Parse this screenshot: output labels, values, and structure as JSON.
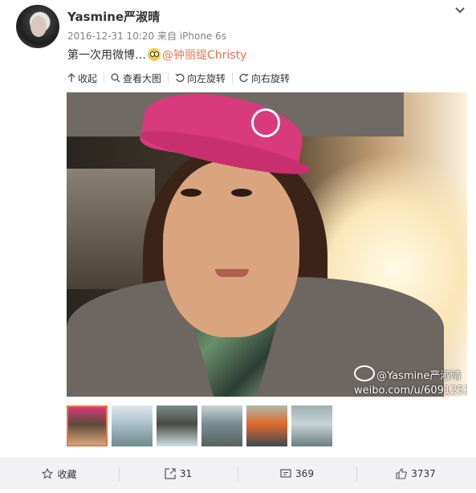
{
  "post": {
    "author": "Yasmine严淑晴",
    "date": "2016-12-31 10:20",
    "source_prefix": "来自",
    "device": "iPhone 6s",
    "text_prefix": "第一次用微博…",
    "mention": "@钟丽缇Christy"
  },
  "toolbar": {
    "collapse": "收起",
    "view_large": "查看大图",
    "rotate_left": "向左旋转",
    "rotate_right": "向右旋转"
  },
  "watermark": {
    "line1": "@Yasmine严淑晴",
    "line2": "weibo.com/u/6091253443"
  },
  "thumbnails": [
    {
      "name": "thumb-1",
      "selected": true,
      "colors": [
        "#5c4a36",
        "#d9a47e",
        "#d83a7c"
      ]
    },
    {
      "name": "thumb-2",
      "selected": false,
      "colors": [
        "#a9c0cc",
        "#6f8a8c",
        "#dfe8ea"
      ]
    },
    {
      "name": "thumb-3",
      "selected": false,
      "colors": [
        "#4a4a44",
        "#cfe0e6",
        "#7c8a88"
      ]
    },
    {
      "name": "thumb-4",
      "selected": false,
      "colors": [
        "#7a8c93",
        "#55625e",
        "#c9d4d6"
      ]
    },
    {
      "name": "thumb-5",
      "selected": false,
      "colors": [
        "#e06a2c",
        "#3d4a52",
        "#b0b8a8"
      ]
    },
    {
      "name": "thumb-6",
      "selected": false,
      "colors": [
        "#c7d3d8",
        "#6d7d7f",
        "#9fb0b3"
      ]
    }
  ],
  "footer": {
    "favorite": "收藏",
    "repost_count": "31",
    "comment_count": "369",
    "like_count": "3737"
  },
  "colors": {
    "accent": "#eb7350",
    "link": "#eb7350"
  }
}
